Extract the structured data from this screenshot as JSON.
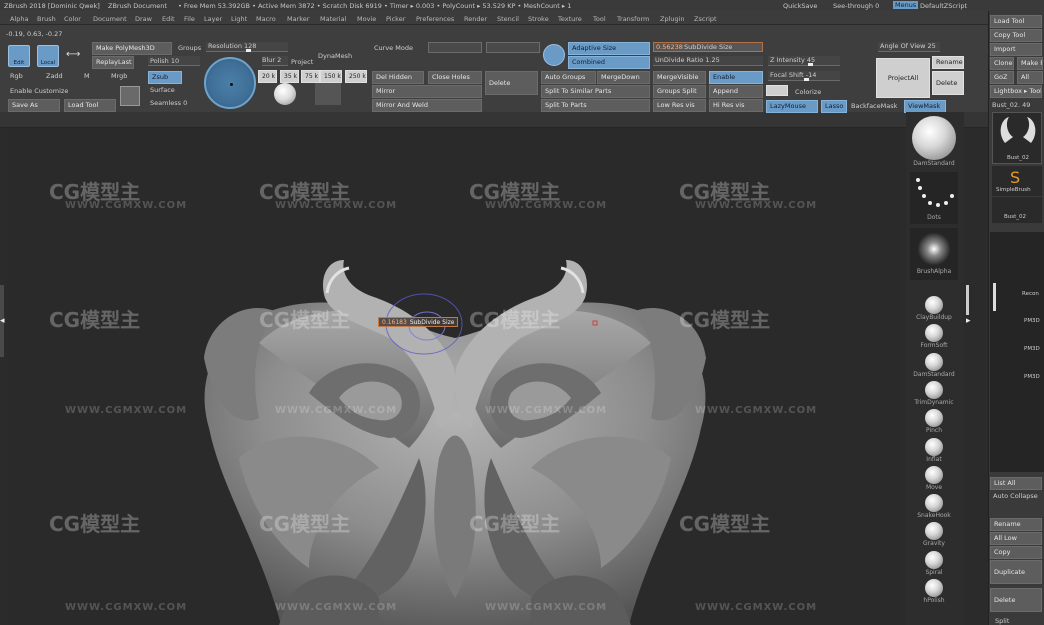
{
  "titlebar": {
    "app": "ZBrush 2018 [Dominic Qwek]",
    "doc": "ZBrush Document",
    "mem": "• Free Mem 53.392GB • Active Mem 3872 • Scratch Disk 6919 • Timer ▸ 0.003 • PolyCount ▸ 53.529 KP • MeshCount ▸ 1",
    "quicksave": "QuickSave",
    "seethrough": "See-through  0",
    "menus": "Menus",
    "script": "DefaultZScript"
  },
  "menubar": [
    "Alpha",
    "Brush",
    "Color",
    "Document",
    "Draw",
    "Edit",
    "File",
    "Layer",
    "Light",
    "Macro",
    "Marker",
    "Material",
    "Movie",
    "Picker",
    "Preferences",
    "Render",
    "Stencil",
    "Stroke",
    "Texture",
    "Tool",
    "Transform",
    "Zplugin",
    "Zscript"
  ],
  "coords": "-0.19, 0.63, -0.27",
  "toolbar": {
    "edit": "Edit",
    "local": "Local",
    "make_polymesh": "Make PolyMesh3D",
    "replay_last": "ReplayLast",
    "groups": "Groups",
    "polish": "Polish 10",
    "resolution": "Resolution 128",
    "zsub": "Zsub",
    "surface": "Surface",
    "seamless": "Seamless 0",
    "rgb": "Rgb",
    "zadd": "Zadd",
    "m": "M",
    "mrgb": "Mrgb",
    "enable_customize": "Enable Customize",
    "save_as": "Save As",
    "load_tool": "Load Tool",
    "brush_sizes": [
      "20 k",
      "35 k",
      "75 k",
      "150 k",
      "250 k"
    ],
    "blur": "Blur 2",
    "project": "Project",
    "dynamesh": "DynaMesh",
    "curve_mode": "Curve Mode",
    "del_hidden": "Del Hidden",
    "close_holes": "Close Holes",
    "mirror": "Mirror",
    "mirror_and_weld": "Mirror And Weld",
    "delete": "Delete",
    "adaptive_size": "Adaptive Size",
    "combined": "Combined",
    "auto_groups": "Auto Groups",
    "merge_down": "MergeDown",
    "split_similar": "Split To Similar Parts",
    "split_parts": "Split To Parts",
    "subdivide_size": "SubDivide Size",
    "subdivide_value": "0.56238",
    "undivide_ratio": "UnDivide Ratio 1.25",
    "merge_visible": "MergeVisible",
    "enable": "Enable",
    "groups_split": "Groups Split",
    "append": "Append",
    "low_res": "Low Res vis",
    "hi_res": "Hi Res vis",
    "z_intensity": "Z Intensity 45",
    "focal_shift": "Focal Shift -14",
    "colorize": "Colorize",
    "lazymouse": "LazyMouse",
    "lasso": "Lasso",
    "backface": "BackfaceMask",
    "viewmask": "ViewMask",
    "angle_of_view": "Angle Of View 25",
    "project_all": "ProjectAll",
    "rename": "Rename",
    "delete2": "Delete"
  },
  "rightpanel": {
    "load_tool": "Load Tool",
    "copy_tool": "Copy Tool",
    "import": "Import",
    "clone": "Clone",
    "make_p": "Make P",
    "goz": "GoZ",
    "all": "All",
    "lightbox": "Lightbox ▸ Tools",
    "bust": "Bust_02. 49",
    "bust_thumb_label": "Bust_02",
    "simplebrush": "SimpleBrush",
    "bust2": "Bust_02",
    "sub_labels": [
      "Recon",
      "PM3D",
      "PM3D",
      "PM3D"
    ],
    "list_all": "List All",
    "auto_collapse": "Auto Collapse",
    "rename": "Rename",
    "all_low": "All Low",
    "copy": "Copy",
    "duplicate": "Duplicate",
    "delete": "Delete",
    "split": "Split"
  },
  "brushes": {
    "dam_standard": "DamStandard",
    "dots": "Dots",
    "brush_alpha": "BrushAlpha",
    "list": [
      "ClayBuildup",
      "FormSoft",
      "DamStandard",
      "TrimDynamic",
      "Pinch",
      "Inflat",
      "Move",
      "SnakeHook",
      "Gravity",
      "Spiral",
      "hPolish"
    ]
  },
  "tooltip": {
    "value": "0.16183",
    "label": "SubDivide Size"
  },
  "watermark": {
    "logo": "CG模型主",
    "url": "WWW.CGMXW.COM"
  },
  "colors": {
    "accent_blue": "#6a9bc7",
    "viewport_bg": "#2a2a2a",
    "panel_bg": "#3e3e3e",
    "clay": "#8c8c8c"
  }
}
